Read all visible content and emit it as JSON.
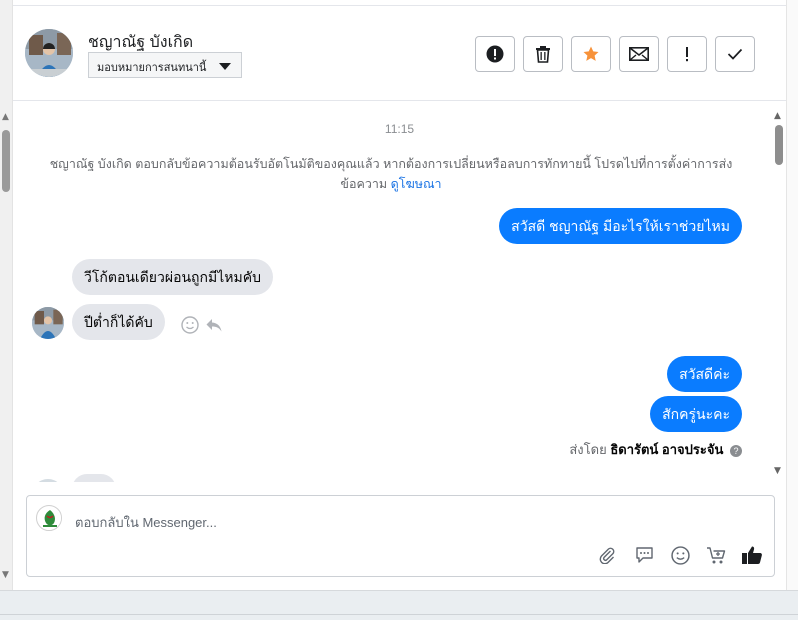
{
  "header": {
    "contact_name": "ชญาณัฐ บังเกิด",
    "assign_label": "มอบหมายการสนทนานี้"
  },
  "toolbar": [
    {
      "name": "spam-button",
      "icon": "exclamation-circle-icon"
    },
    {
      "name": "delete-button",
      "icon": "trash-icon"
    },
    {
      "name": "star-button",
      "icon": "star-icon",
      "color": "#f7923a"
    },
    {
      "name": "mark-unread-button",
      "icon": "envelope-icon"
    },
    {
      "name": "follow-up-button",
      "icon": "exclamation-icon"
    },
    {
      "name": "done-button",
      "icon": "check-icon"
    }
  ],
  "chat": {
    "timestamp": "11:15",
    "notice_text": "ชญาณัฐ บังเกิด ตอบกลับข้อความต้อนรับอัตโนมัติของคุณแล้ว หากต้องการเปลี่ยนหรือลบการทักทายนี้ โปรดไปที่การตั้งค่าการส่งข้อความ",
    "notice_link": "ดูโฆษณา",
    "messages": [
      {
        "direction": "out",
        "text": "สวัสดี ชญาณัฐ มีอะไรให้เราช่วยไหม"
      },
      {
        "direction": "in",
        "text": "วีโก้ตอนเดียวผ่อนถูกมีไหมคับ"
      },
      {
        "direction": "in",
        "text": "ปีต่ำก็ได้คับ"
      },
      {
        "direction": "out",
        "text": "สวัสดีค่ะ"
      },
      {
        "direction": "out",
        "text": "สักครู่นะคะ"
      }
    ],
    "sent_by_prefix": "ส่งโดย",
    "sent_by_name": "ธิดารัตน์ อาจประจัน",
    "accent_color": "#0a7cff"
  },
  "composer": {
    "placeholder": "ตอบกลับใน Messenger...",
    "icons": [
      "paperclip-icon",
      "speech-bubble-icon",
      "smiley-icon",
      "cart-icon",
      "thumbs-up-icon"
    ]
  }
}
